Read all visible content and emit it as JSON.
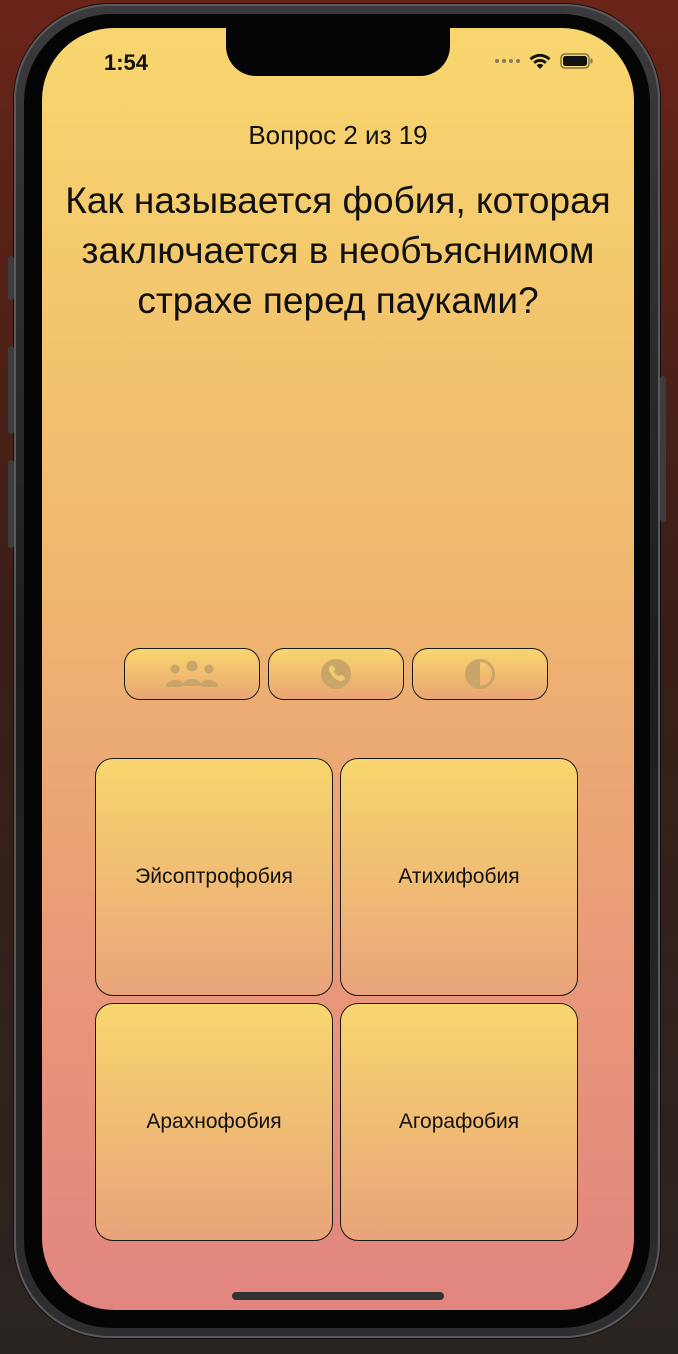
{
  "status_bar": {
    "time": "1:54"
  },
  "quiz": {
    "counter": "Вопрос 2 из 19",
    "question": "Как называется фобия, которая заключается в необъяснимом страхе перед пауками?",
    "answers": [
      {
        "label": "Эйсоптрофобия"
      },
      {
        "label": "Атихифобия"
      },
      {
        "label": "Арахнофобия"
      },
      {
        "label": "Агорафобия"
      }
    ]
  },
  "lifelines": [
    {
      "icon": "audience-icon"
    },
    {
      "icon": "phone-icon"
    },
    {
      "icon": "fifty-fifty-icon"
    }
  ],
  "colors": {
    "gradient_top": "#f8d66e",
    "gradient_bottom": "#e18580",
    "icon_disabled": "#c9a56a"
  }
}
